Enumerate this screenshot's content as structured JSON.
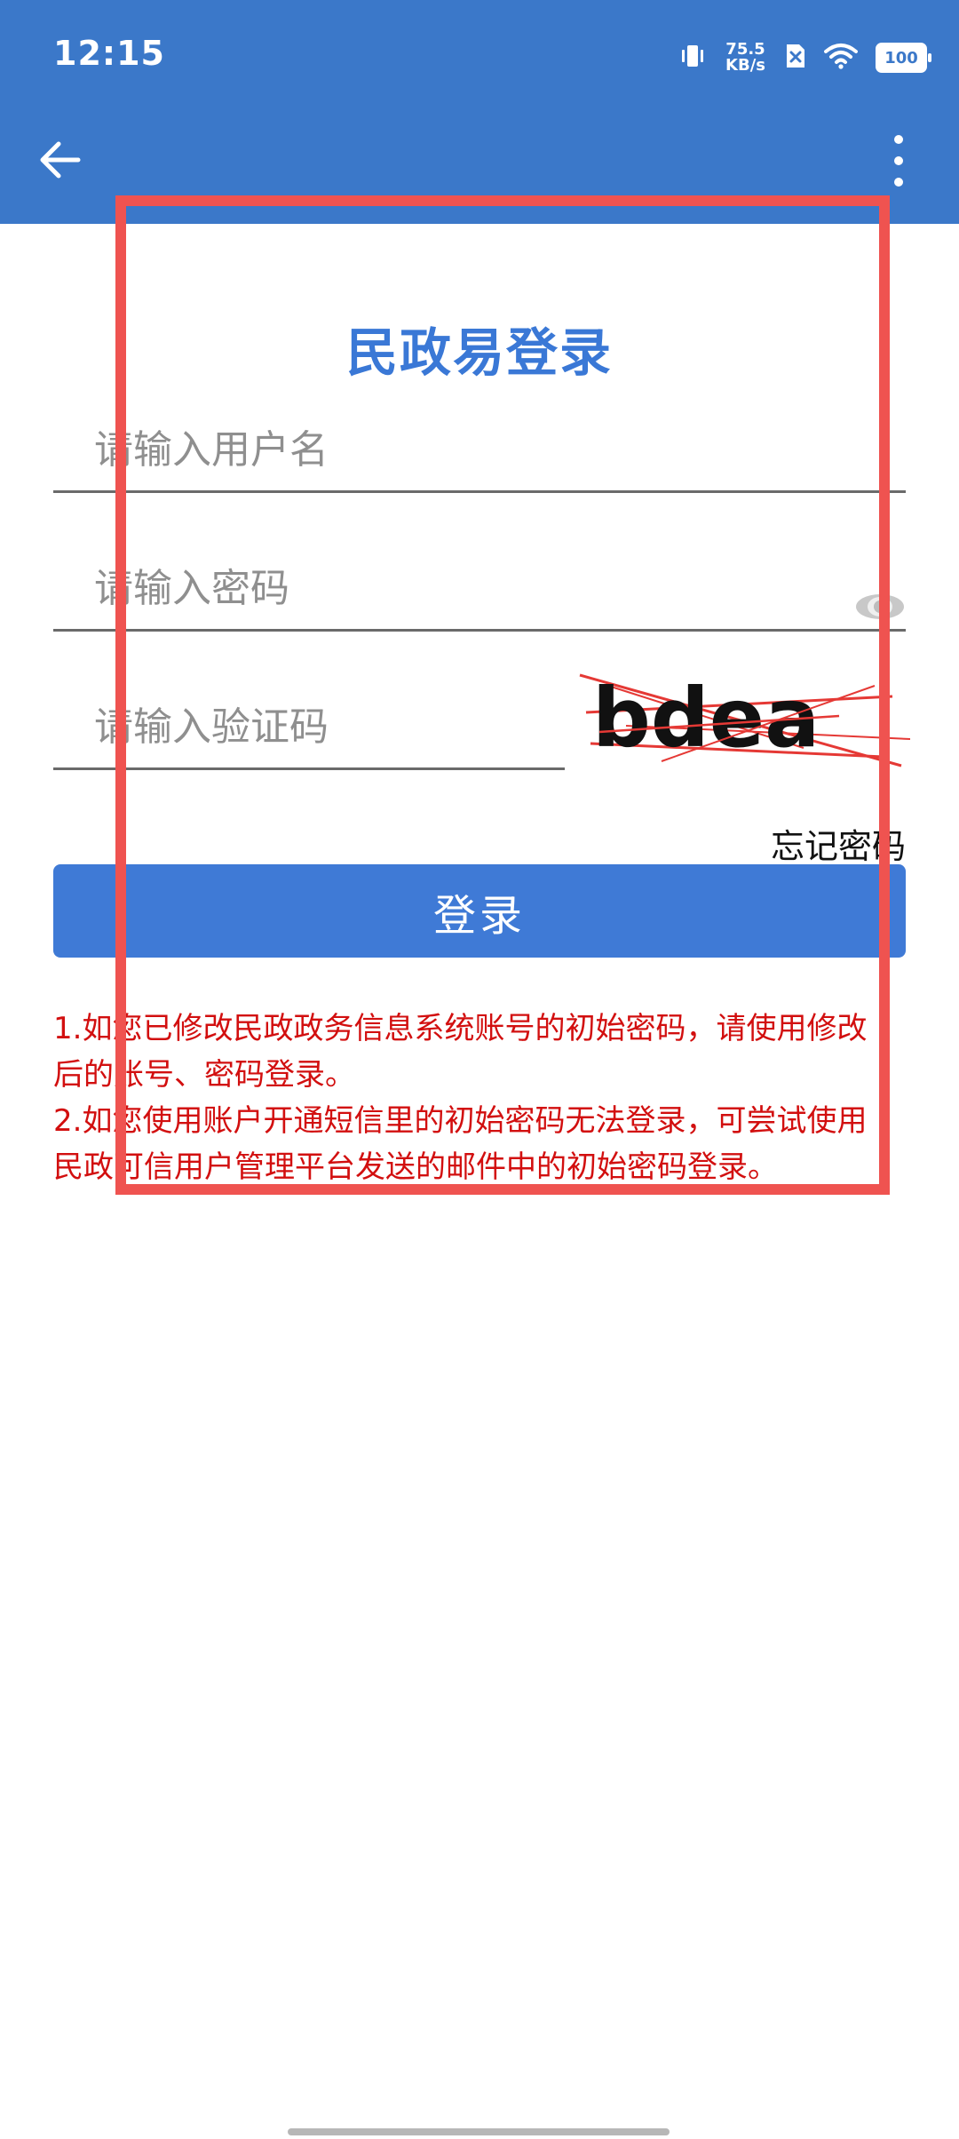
{
  "status_bar": {
    "time": "12:15",
    "speed_value": "75.5",
    "speed_unit": "KB/s",
    "battery": "100"
  },
  "header": {
    "back_icon": "back-arrow-icon",
    "more_icon": "more-vertical-icon"
  },
  "login": {
    "title": "民政易登录",
    "username_placeholder": "请输入用户名",
    "password_placeholder": "请输入密码",
    "captcha_placeholder": "请输入验证码",
    "captcha_text": "bdea",
    "forgot_password": "忘记密码",
    "submit_label": "登录"
  },
  "notices": [
    "1.如您已修改民政政务信息系统账号的初始密码，请使用修改后的账号、密码登录。",
    "2.如您使用账户开通短信里的初始密码无法登录，可尝试使用民政可信用户管理平台发送的邮件中的初始密码登录。"
  ],
  "colors": {
    "header": "#3b78c9",
    "title": "#3a78d6",
    "button": "#3f7ad6",
    "notice": "#d20f0f",
    "highlight": "#ef5350"
  }
}
